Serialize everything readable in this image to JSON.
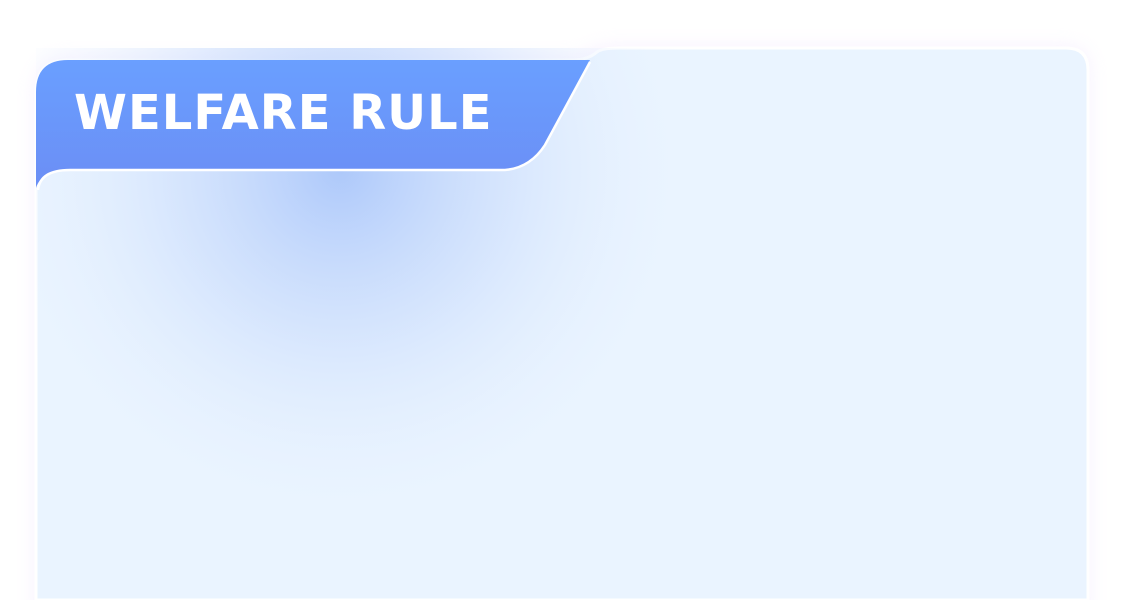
{
  "card": {
    "title": "WELFARE RULE"
  },
  "colors": {
    "tab_blue": "#6b9dfd",
    "panel_bg": "#eaf4ff",
    "border_white": "#ffffff",
    "title_text": "#ffffff"
  }
}
